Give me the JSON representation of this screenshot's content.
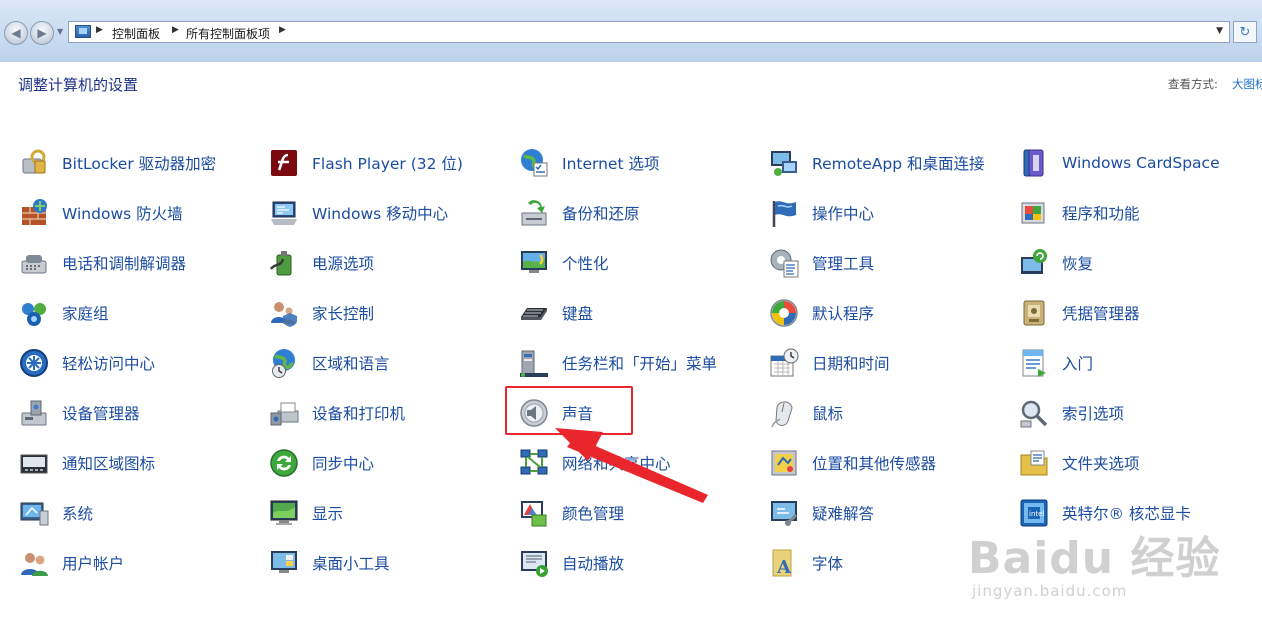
{
  "addressbar": {
    "crumbs": [
      "控制面板",
      "所有控制面板项"
    ]
  },
  "page": {
    "heading": "调整计算机的设置",
    "view_label": "查看方式:",
    "view_value": "大图标"
  },
  "items": [
    {
      "label": "BitLocker 驱动器加密",
      "icon": "bitlocker-icon"
    },
    {
      "label": "Windows 防火墙",
      "icon": "firewall-icon"
    },
    {
      "label": "电话和调制解调器",
      "icon": "phone-modem-icon"
    },
    {
      "label": "家庭组",
      "icon": "homegroup-icon"
    },
    {
      "label": "轻松访问中心",
      "icon": "ease-of-access-icon"
    },
    {
      "label": "设备管理器",
      "icon": "device-manager-icon"
    },
    {
      "label": "通知区域图标",
      "icon": "notification-area-icon"
    },
    {
      "label": "系统",
      "icon": "system-icon"
    },
    {
      "label": "用户帐户",
      "icon": "user-accounts-icon"
    },
    {
      "label": "Flash Player (32 位)",
      "icon": "flash-player-icon"
    },
    {
      "label": "Windows 移动中心",
      "icon": "mobility-center-icon"
    },
    {
      "label": "电源选项",
      "icon": "power-options-icon"
    },
    {
      "label": "家长控制",
      "icon": "parental-controls-icon"
    },
    {
      "label": "区域和语言",
      "icon": "region-language-icon"
    },
    {
      "label": "设备和打印机",
      "icon": "devices-printers-icon"
    },
    {
      "label": "同步中心",
      "icon": "sync-center-icon"
    },
    {
      "label": "显示",
      "icon": "display-icon"
    },
    {
      "label": "桌面小工具",
      "icon": "gadgets-icon"
    },
    {
      "label": "Internet 选项",
      "icon": "internet-options-icon"
    },
    {
      "label": "备份和还原",
      "icon": "backup-restore-icon"
    },
    {
      "label": "个性化",
      "icon": "personalization-icon"
    },
    {
      "label": "键盘",
      "icon": "keyboard-icon"
    },
    {
      "label": "任务栏和「开始」菜单",
      "icon": "taskbar-start-icon"
    },
    {
      "label": "声音",
      "icon": "sound-icon"
    },
    {
      "label": "网络和共享中心",
      "icon": "network-sharing-icon"
    },
    {
      "label": "颜色管理",
      "icon": "color-management-icon"
    },
    {
      "label": "自动播放",
      "icon": "autoplay-icon"
    },
    {
      "label": "RemoteApp 和桌面连接",
      "icon": "remoteapp-icon"
    },
    {
      "label": "操作中心",
      "icon": "action-center-icon"
    },
    {
      "label": "管理工具",
      "icon": "admin-tools-icon"
    },
    {
      "label": "默认程序",
      "icon": "default-programs-icon"
    },
    {
      "label": "日期和时间",
      "icon": "date-time-icon"
    },
    {
      "label": "鼠标",
      "icon": "mouse-icon"
    },
    {
      "label": "位置和其他传感器",
      "icon": "location-sensors-icon"
    },
    {
      "label": "疑难解答",
      "icon": "troubleshooting-icon"
    },
    {
      "label": "字体",
      "icon": "fonts-icon"
    },
    {
      "label": "Windows CardSpace",
      "icon": "cardspace-icon"
    },
    {
      "label": "程序和功能",
      "icon": "programs-features-icon"
    },
    {
      "label": "恢复",
      "icon": "recovery-icon"
    },
    {
      "label": "凭据管理器",
      "icon": "credential-manager-icon"
    },
    {
      "label": "入门",
      "icon": "getting-started-icon"
    },
    {
      "label": "索引选项",
      "icon": "indexing-options-icon"
    },
    {
      "label": "文件夹选项",
      "icon": "folder-options-icon"
    },
    {
      "label": "英特尔® 核芯显卡",
      "icon": "intel-graphics-icon"
    }
  ],
  "watermark": {
    "brand": "Baidu 经验",
    "url": "jingyan.baidu.com"
  },
  "colors": {
    "link": "#1c4da1",
    "heading": "#1e3287",
    "annotation": "#e8262c"
  }
}
